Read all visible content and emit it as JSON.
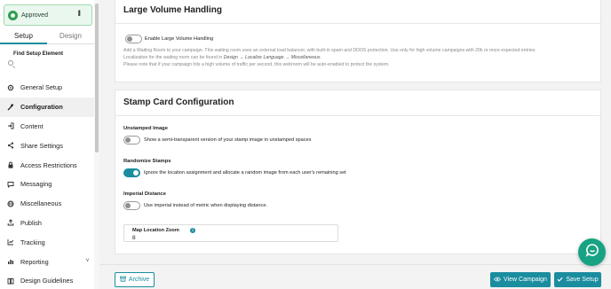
{
  "status": {
    "label": "Approved",
    "color": "#2e9e55"
  },
  "tabs": [
    {
      "label": "Setup",
      "active": true
    },
    {
      "label": "Design",
      "active": false
    }
  ],
  "find": {
    "label": "Find Setup Element",
    "placeholder": ""
  },
  "nav": [
    {
      "label": "General Setup",
      "icon": "gear-icon"
    },
    {
      "label": "Configuration",
      "icon": "wrench-icon",
      "active": true
    },
    {
      "label": "Content",
      "icon": "login-icon"
    },
    {
      "label": "Share Settings",
      "icon": "share-icon"
    },
    {
      "label": "Access Restrictions",
      "icon": "lock-icon"
    },
    {
      "label": "Messaging",
      "icon": "chat-icon"
    },
    {
      "label": "Miscellaneous",
      "icon": "globe-icon"
    },
    {
      "label": "Publish",
      "icon": "upload-icon"
    },
    {
      "label": "Tracking",
      "icon": "tracking-icon"
    },
    {
      "label": "Reporting",
      "icon": "chart-icon",
      "chevron": "v"
    },
    {
      "label": "Design Guidelines",
      "icon": "book-icon"
    }
  ],
  "large_volume": {
    "title": "Large Volume Handling",
    "toggle_label": "Enable Large Volume Handling",
    "toggle_on": false,
    "desc_line1": "Add a Waiting Room to your campaign. This waiting room uses an external load balancer, with built-in spam and DDOS protection. Use only for high volume campaigns with 20k or more expected entries.",
    "desc_line2_prefix": "Localization for the waiting room can be found in ",
    "desc_line2_path": "Design → Localize Language → Miscellaneous",
    "desc_line2_suffix": ".",
    "desc_line3": "Please note that if your campaign hits a high volume of traffic per second, this webroom will be auto-enabled to protect the system."
  },
  "stamp_card": {
    "title": "Stamp Card Configuration",
    "unstamped": {
      "heading": "Unstamped Image",
      "label": "Show a semi-transparent version of your stamp image in unstamped spaces",
      "on": false
    },
    "randomize": {
      "heading": "Randomize Stamps",
      "label": "Ignore the location assignment and allocate a random image from each user's remaining set",
      "on": true
    },
    "imperial": {
      "heading": "Imperial Distance",
      "label": "Use imperial instead of metric when displaying distance.",
      "on": false
    },
    "zoom": {
      "label": "Map Location Zoom",
      "value": "8",
      "info": "i"
    }
  },
  "footer": {
    "archive": "Archive",
    "view": "View Campaign",
    "save": "Save Setup"
  },
  "colors": {
    "accent": "#1a8d9f",
    "chat_fab": "#17a383"
  }
}
